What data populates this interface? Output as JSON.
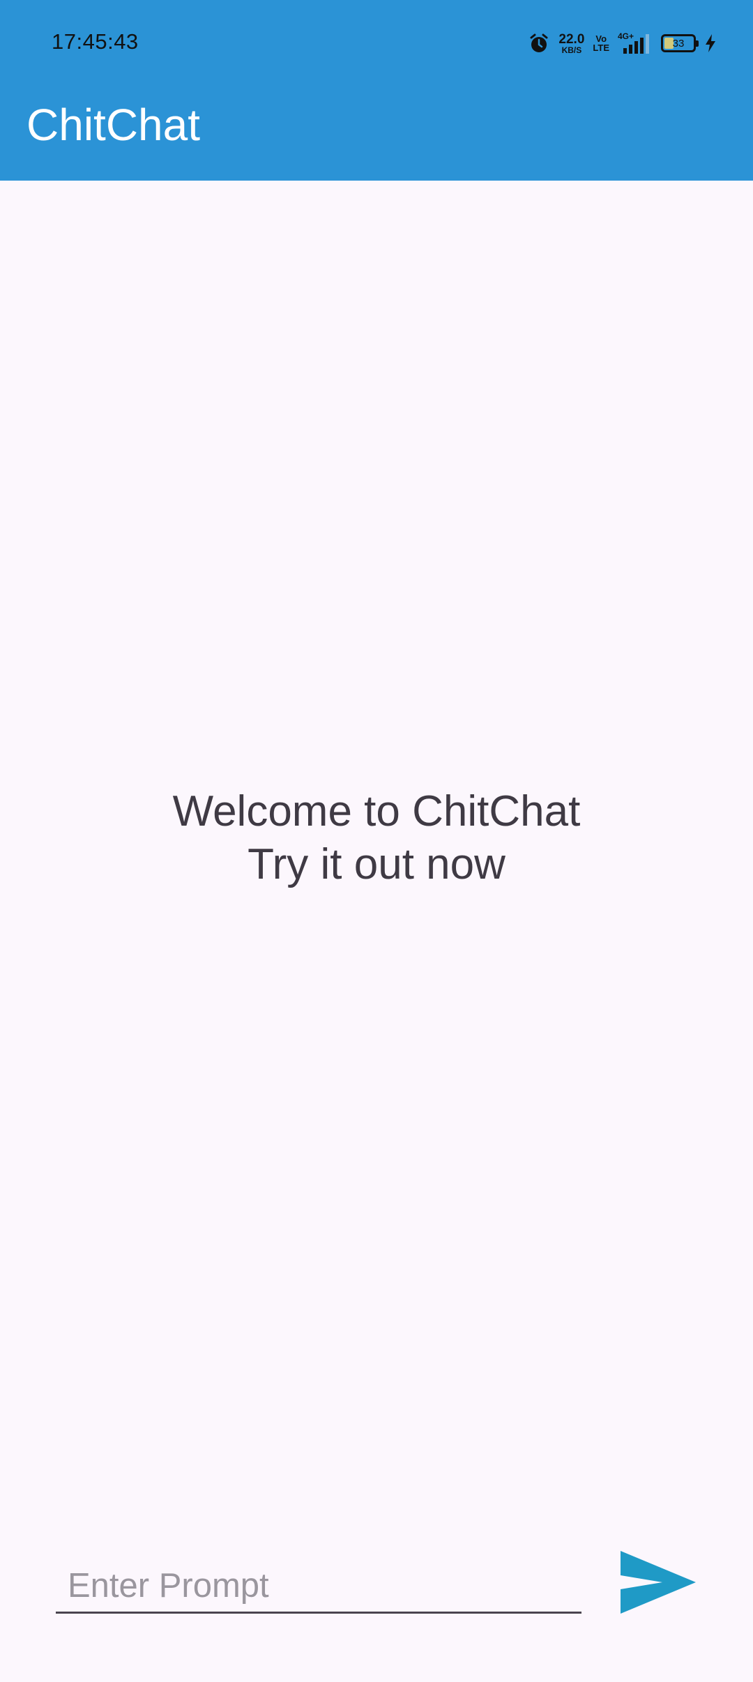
{
  "status_bar": {
    "time": "17:45:43",
    "net_speed_value": "22.0",
    "net_speed_unit": "KB/S",
    "volte_top": "Vo",
    "volte_bottom": "LTE",
    "network_type": "4G+",
    "battery_level": "33",
    "battery_fraction": 0.33,
    "icons": [
      "alarm-icon",
      "volte-icon",
      "signal-icon",
      "battery-icon",
      "charging-icon"
    ]
  },
  "app_bar": {
    "title": "ChitChat",
    "color": "#2b93d6"
  },
  "main": {
    "welcome_line1": "Welcome to ChitChat",
    "welcome_line2": "Try it out now"
  },
  "prompt": {
    "placeholder": "Enter Prompt",
    "value": "",
    "send_icon": "send-icon",
    "send_color": "#1f9ac6"
  }
}
